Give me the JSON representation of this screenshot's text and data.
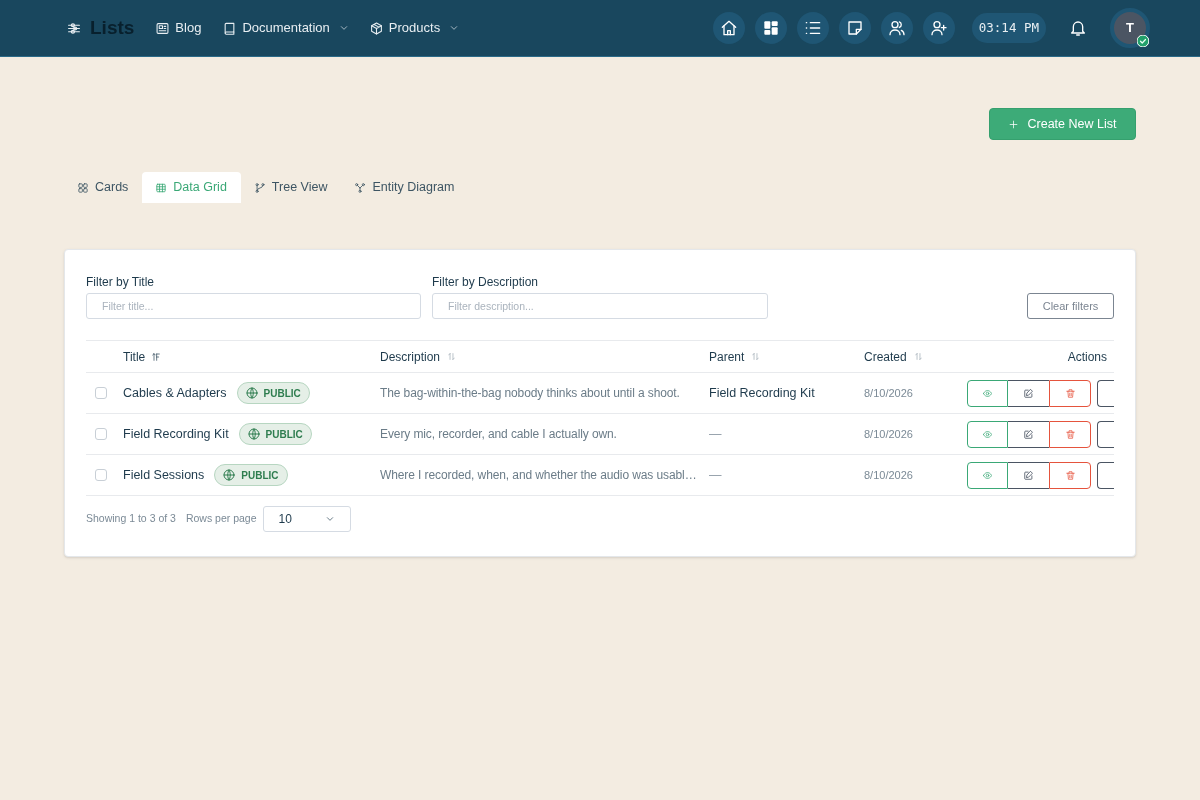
{
  "nav": {
    "brand": "Lists",
    "links": [
      {
        "label": "Blog",
        "kind": "link"
      },
      {
        "label": "Documentation",
        "kind": "dropdown"
      },
      {
        "label": "Products",
        "kind": "dropdown"
      }
    ],
    "time": "03:14 PM",
    "avatar": "T"
  },
  "create_button": "Create New List",
  "tabs": [
    {
      "label": "Cards",
      "selected": false
    },
    {
      "label": "Data Grid",
      "selected": true
    },
    {
      "label": "Tree View",
      "selected": false
    },
    {
      "label": "Entity Diagram",
      "selected": false
    }
  ],
  "filters": [
    {
      "label": "Filter by Title",
      "placeholder": "Filter title..."
    },
    {
      "label": "Filter by Description",
      "placeholder": "Filter description..."
    }
  ],
  "clear_button": "Clear filters",
  "table": {
    "columns": [
      {
        "label": "Title",
        "kind": "sortable",
        "sorted": true
      },
      {
        "label": "Description",
        "kind": "sortable",
        "sorted": false
      },
      {
        "label": "Parent",
        "kind": "sortable",
        "sorted": false
      },
      {
        "label": "Created",
        "kind": "sortable",
        "sorted": false
      },
      {
        "label": "Actions",
        "kind": "plain"
      }
    ],
    "rows": [
      {
        "checked": false,
        "title": "Cables & Adapters",
        "visibility": "PUBLIC",
        "description": "The bag-within-the-bag nobody thinks about until a shoot.",
        "parent": {
          "label": "Field Recording Kit",
          "kind": "link"
        },
        "created": "8/10/2026"
      },
      {
        "checked": false,
        "title": "Field Recording Kit",
        "visibility": "PUBLIC",
        "description": "Every mic, recorder, and cable I actually own.",
        "parent": {
          "label": "—",
          "kind": "empty"
        },
        "created": "8/10/2026"
      },
      {
        "checked": false,
        "title": "Field Sessions",
        "visibility": "PUBLIC",
        "description": "Where I recorded, when, and whether the audio was usabl…",
        "parent": {
          "label": "—",
          "kind": "empty"
        },
        "created": "8/10/2026"
      }
    ]
  },
  "footer": {
    "summary": "Showing 1 to 3 of 3",
    "rows_per_page_label": "Rows per page",
    "rows_per_page": "10"
  }
}
